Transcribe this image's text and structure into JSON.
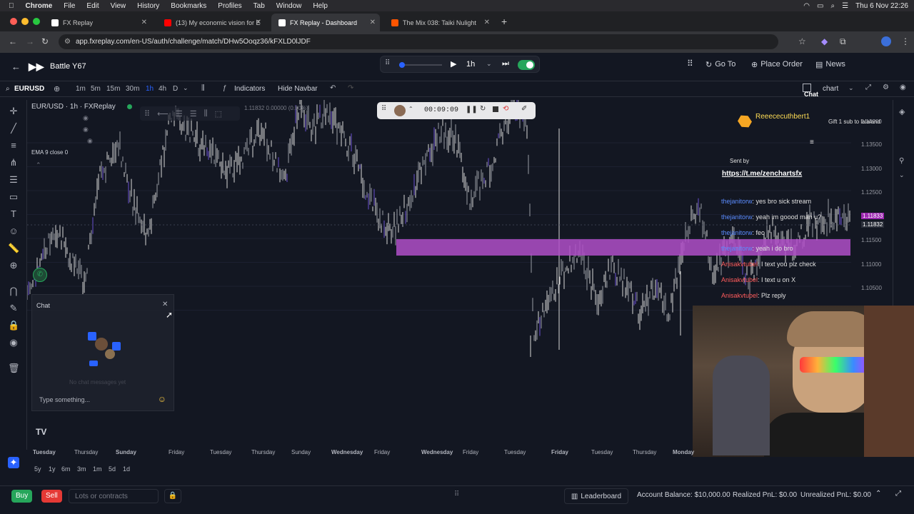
{
  "menubar": {
    "apple": "",
    "app": "Chrome",
    "items": [
      "File",
      "Edit",
      "View",
      "History",
      "Bookmarks",
      "Profiles",
      "Tab",
      "Window",
      "Help"
    ],
    "datetime": "Thu 6 Nov 22:26"
  },
  "tabs": [
    {
      "label": "FX Replay",
      "color": "#ffffff",
      "active": false
    },
    {
      "label": "(13) My economic vision for E",
      "color": "#ff0000",
      "active": false
    },
    {
      "label": "FX Replay - Dashboard",
      "color": "#ffffff",
      "active": true
    },
    {
      "label": "The Mix 038: Taiki Nulight",
      "color": "#ff5500",
      "active": false
    }
  ],
  "address": {
    "url": "app.fxreplay.com/en-US/auth/challenge/match/DHw5Ooqz36/kFXLD0lJDF"
  },
  "header": {
    "title": "Battle Y67",
    "timeframe": "1h",
    "go_to": "Go To",
    "place_order": "Place Order",
    "news": "News"
  },
  "chart_toolbar": {
    "symbol": "EURUSD",
    "timeframes": [
      "1m",
      "5m",
      "15m",
      "30m",
      "1h",
      "4h",
      "D"
    ],
    "active_tf": "1h",
    "indicators": "Indicators",
    "hide_navbar": "Hide Navbar",
    "chart_label": "chart",
    "chat_label": "Chat"
  },
  "chart": {
    "legend_title": "EUR/USD · 1h · FXReplay",
    "ema_label": "EMA 9 close 0",
    "ohlc_readout": "1.11832  0.00000 (0.00%)",
    "timer": "00:09:09",
    "price_ticks": [
      "1.14200",
      "1.13500",
      "1.13000",
      "1.12500",
      "1.12000",
      "1.11500",
      "1.11000",
      "1.10500"
    ],
    "price_current": "1.11833",
    "price_current2": "1.11832",
    "x_ticks": [
      "Tuesday",
      "Thursday",
      "Sunday",
      "Friday",
      "Tuesday",
      "Thursday",
      "Sunday",
      "Wednesday",
      "Friday",
      "Wednesday",
      "Friday",
      "Tuesday",
      "Friday",
      "Tuesday",
      "Thursday",
      "Monday"
    ],
    "ranges": [
      "5y",
      "1y",
      "6m",
      "3m",
      "1m",
      "5d",
      "1d"
    ],
    "zone_color": "#b04fc8"
  },
  "stream_chat": {
    "top_user": "Reeececuthbert1",
    "gift": "Gift 1 sub to lalaland",
    "sent_by": "Sent by",
    "link": "https://t.me/zenchartsfx",
    "messages": [
      {
        "user": "thejanitorw",
        "text": "yes bro sick stream"
      },
      {
        "user": "thejanitorw",
        "text": "yeah im goood man u?"
      },
      {
        "user": "thejanitorw",
        "text": "feo"
      },
      {
        "user": "thejanitorw",
        "text": "yeah i do bro"
      },
      {
        "user": "Anisakvtubel",
        "text": "I text you plz check"
      },
      {
        "user": "Anisakvtubel",
        "text": "I text u on X"
      },
      {
        "user": "Anisakvtubel",
        "text": "Plz reply"
      }
    ]
  },
  "chat_panel": {
    "title": "Chat",
    "empty": "No chat messages yet",
    "placeholder": "Type something..."
  },
  "bottom": {
    "buy": "Buy",
    "sell": "Sell",
    "lots_placeholder": "Lots or contracts",
    "leaderboard": "Leaderboard",
    "account_balance": "Account Balance: $10,000.00",
    "realized": "Realized PnL: $0.00",
    "unrealized": "Unrealized PnL: $0.00"
  }
}
